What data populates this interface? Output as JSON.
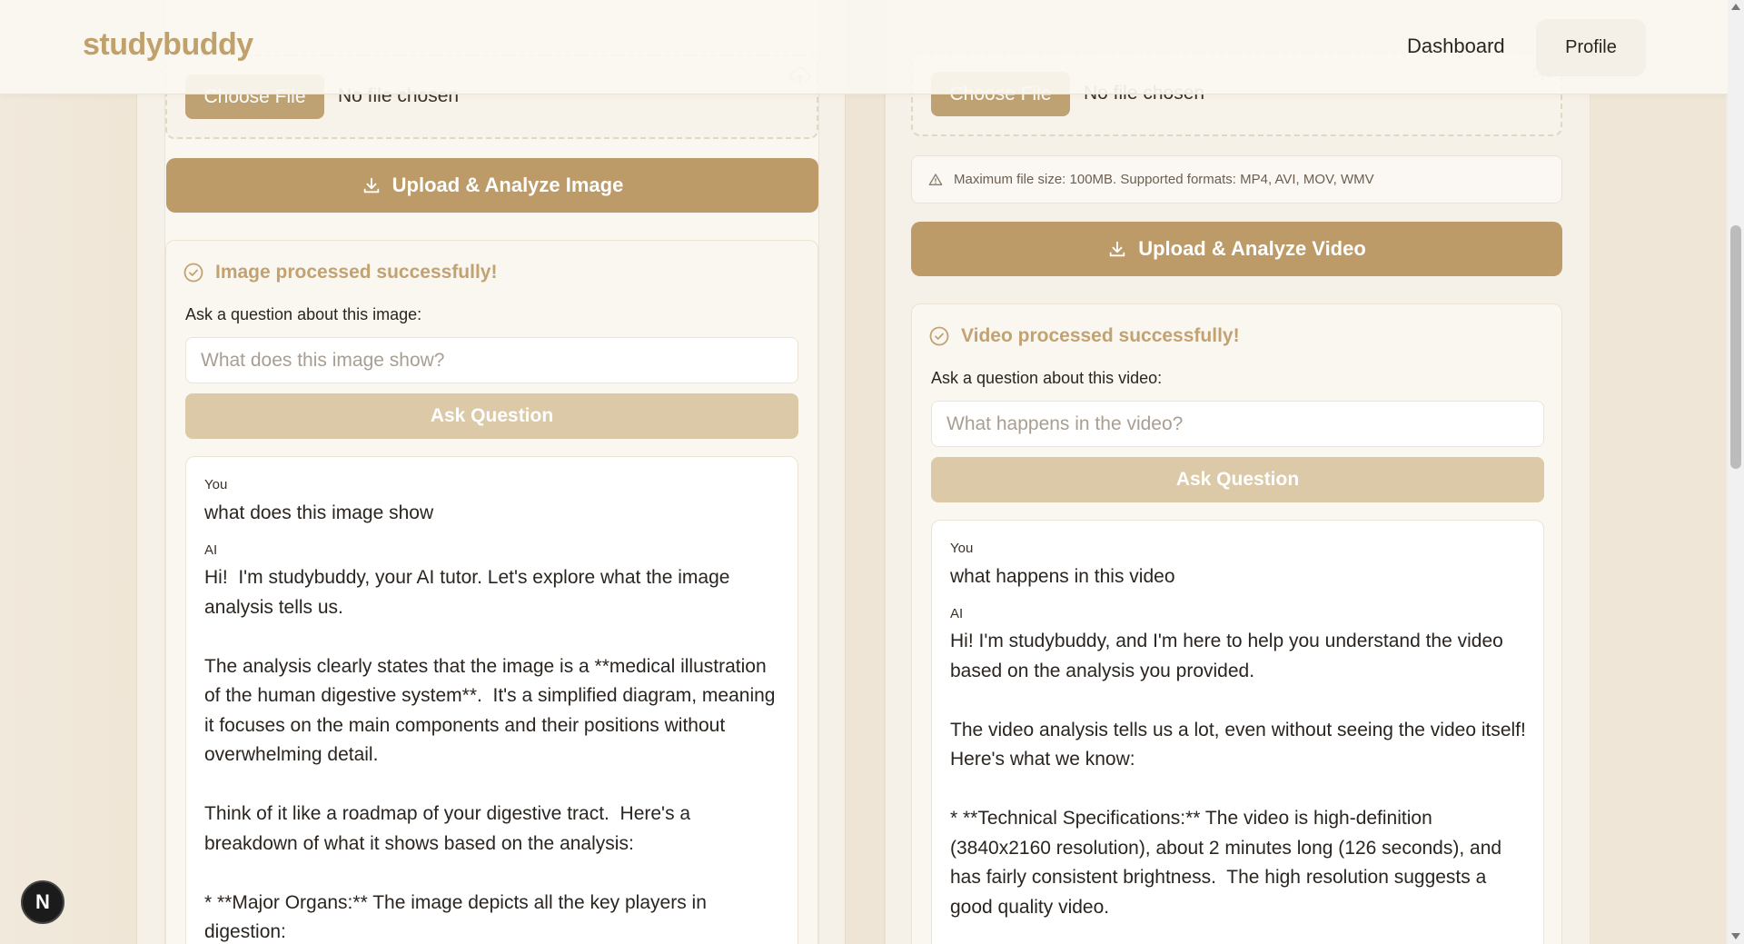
{
  "header": {
    "logo": "studybuddy",
    "nav": {
      "dashboard": "Dashboard",
      "profile": "Profile"
    }
  },
  "image_panel": {
    "choose_file": "Choose File",
    "no_file": "No file chosen",
    "upload_button": "Upload & Analyze Image",
    "success": "Image processed successfully!",
    "ask_label": "Ask a question about this image:",
    "ask_placeholder": "What does this image show?",
    "ask_button": "Ask Question",
    "chat": {
      "user_role": "You",
      "user_message": "what does this image show",
      "ai_role": "AI",
      "ai_message": "Hi!  I'm studybuddy, your AI tutor. Let's explore what the image\nanalysis tells us.\n\nThe analysis clearly states that the image is a **medical illustration\nof the human digestive system**.  It's a simplified diagram, meaning\nit focuses on the main components and their positions without\noverwhelming detail.\n\nThink of it like a roadmap of your digestive tract.  Here's a\nbreakdown of what it shows based on the analysis:\n\n* **Major Organs:** The image depicts all the key players in\ndigestion:"
    }
  },
  "video_panel": {
    "choose_file": "Choose File",
    "no_file": "No file chosen",
    "note": "Maximum file size: 100MB. Supported formats: MP4, AVI, MOV, WMV",
    "upload_button": "Upload & Analyze Video",
    "success": "Video processed successfully!",
    "ask_label": "Ask a question about this video:",
    "ask_placeholder": "What happens in the video?",
    "ask_button": "Ask Question",
    "chat": {
      "user_role": "You",
      "user_message": "what happens in this video",
      "ai_role": "AI",
      "ai_message": "Hi! I'm studybuddy, and I'm here to help you understand the video\nbased on the analysis you provided.\n\nThe video analysis tells us a lot, even without seeing the video itself!\nHere's what we know:\n\n* **Technical Specifications:** The video is high-definition\n(3840x2160 resolution), about 2 minutes long (126 seconds), and\nhas fairly consistent brightness.  The high resolution suggests a\ngood quality video."
    }
  },
  "badge": "N",
  "colors": {
    "accent": "#bc9b68",
    "accent_light": "#dcc9a8",
    "success": "#c2a271",
    "background": "#f3ece0"
  },
  "icons": [
    "upload-cloud-icon",
    "download-icon",
    "check-circle-icon",
    "warning-icon"
  ]
}
